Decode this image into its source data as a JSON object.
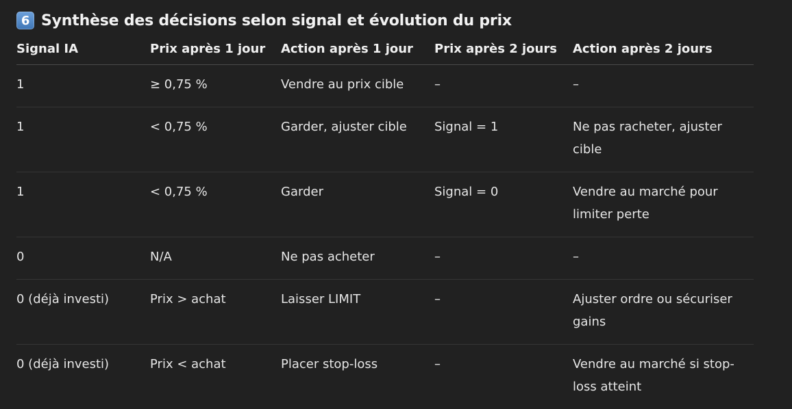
{
  "section": {
    "badge": "6",
    "title": "Synthèse des décisions selon signal et évolution du prix"
  },
  "table": {
    "headers": [
      "Signal IA",
      "Prix après 1 jour",
      "Action après 1 jour",
      "Prix après 2 jours",
      "Action après 2 jours"
    ],
    "rows": [
      [
        "1",
        "≥ 0,75 %",
        "Vendre au prix cible",
        "–",
        "–"
      ],
      [
        "1",
        "< 0,75 %",
        "Garder, ajuster cible",
        "Signal = 1",
        "Ne pas racheter, ajuster cible"
      ],
      [
        "1",
        "< 0,75 %",
        "Garder",
        "Signal = 0",
        "Vendre au marché pour limiter perte"
      ],
      [
        "0",
        "N/A",
        "Ne pas acheter",
        "–",
        "–"
      ],
      [
        "0 (déjà investi)",
        "Prix > achat",
        "Laisser LIMIT",
        "–",
        "Ajuster ordre ou sécuriser gains"
      ],
      [
        "0 (déjà investi)",
        "Prix < achat",
        "Placer stop-loss",
        "–",
        "Vendre au marché si stop-loss atteint"
      ]
    ]
  }
}
